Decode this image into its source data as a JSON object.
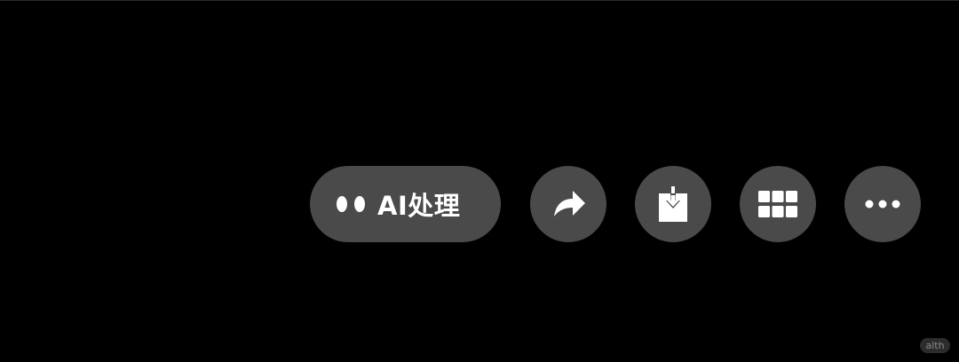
{
  "toolbar": {
    "ai_button": {
      "label": "AI处理",
      "icon": "two-dots-icon"
    },
    "share_button": {
      "icon": "share-arrow-icon"
    },
    "save_button": {
      "icon": "download-icon"
    },
    "grid_button": {
      "icon": "grid-icon"
    },
    "more_button": {
      "icon": "more-dots-icon"
    }
  },
  "watermark": {
    "text": "alth"
  },
  "colors": {
    "background": "#000000",
    "button": "#4a4a4a",
    "foreground": "#ffffff"
  }
}
